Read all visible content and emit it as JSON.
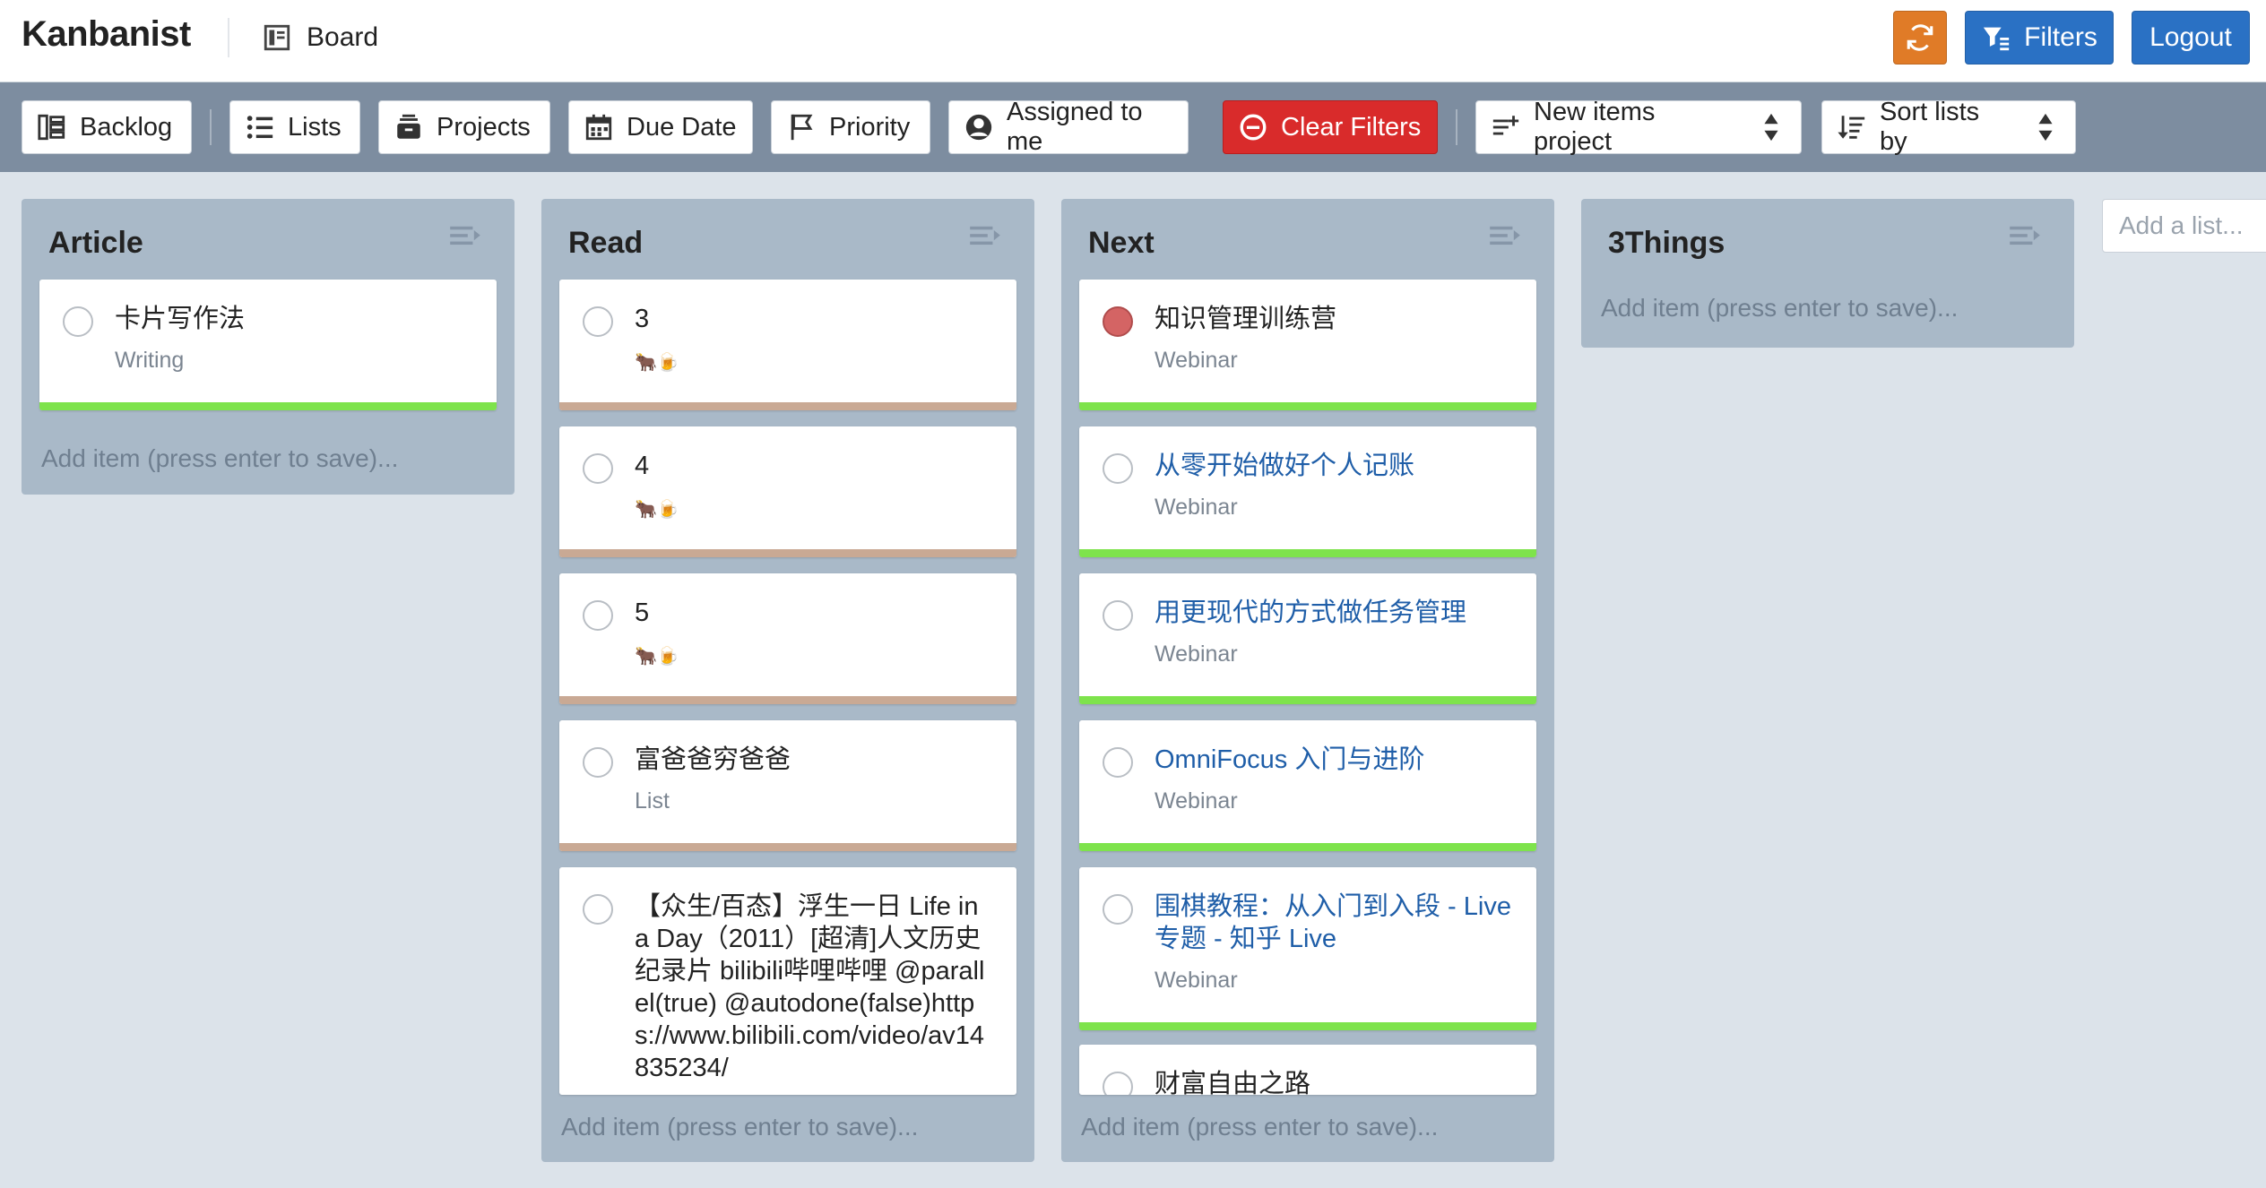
{
  "app": {
    "name": "Kanbanist",
    "board_label": "Board"
  },
  "header": {
    "filters_label": "Filters",
    "logout_label": "Logout"
  },
  "toolbar": {
    "backlog": "Backlog",
    "lists": "Lists",
    "projects": "Projects",
    "due_date": "Due Date",
    "priority": "Priority",
    "assigned": "Assigned to me",
    "clear_filters": "Clear Filters",
    "new_items_project": "New items project",
    "sort_lists": "Sort lists by"
  },
  "add_item_placeholder": "Add item (press enter to save)...",
  "add_list_placeholder": "Add a list...",
  "lists": [
    {
      "title": "Article",
      "cards": [
        {
          "title": "卡片写作法",
          "sub": "Writing",
          "bar": "#7ee34c"
        }
      ]
    },
    {
      "title": "Read",
      "cards": [
        {
          "title": "3",
          "emoji": "🐂🍺",
          "bar": "#c9a994"
        },
        {
          "title": "4",
          "emoji": "🐂🍺",
          "bar": "#c9a994"
        },
        {
          "title": "5",
          "emoji": "🐂🍺",
          "bar": "#c9a994"
        },
        {
          "title": "富爸爸穷爸爸",
          "sub": "List",
          "bar": "#c9a994"
        },
        {
          "title": "【众生/百态】浮生一日 Life in a Day（2011）[超清]人文历史纪录片 bilibili哔哩哔哩 @parallel(true) @autodone(false)https://www.bilibili.com/video/av14835234/"
        }
      ]
    },
    {
      "title": "Next",
      "cards": [
        {
          "title": "知识管理训练营",
          "sub": "Webinar",
          "bar": "#7ee34c",
          "priority": "red"
        },
        {
          "title": "从零开始做好个人记账",
          "sub": "Webinar",
          "bar": "#7ee34c"
        },
        {
          "title": "用更现代的方式做任务管理",
          "sub": "Webinar",
          "bar": "#7ee34c"
        },
        {
          "title": "OmniFocus 入门与进阶",
          "sub": "Webinar",
          "bar": "#7ee34c"
        },
        {
          "title": "围棋教程：从入门到入段 - Live 专题 - 知乎 Live",
          "sub": "Webinar",
          "bar": "#7ee34c"
        },
        {
          "title": "财富自由之路"
        }
      ]
    },
    {
      "title": "3Things",
      "cards": []
    }
  ],
  "colors": {
    "accent": "#2a71c4",
    "sync": "#e07b27",
    "danger": "#d92b2b",
    "toolbar": "#7d8da0",
    "list_bg": "#a9b9c8"
  }
}
